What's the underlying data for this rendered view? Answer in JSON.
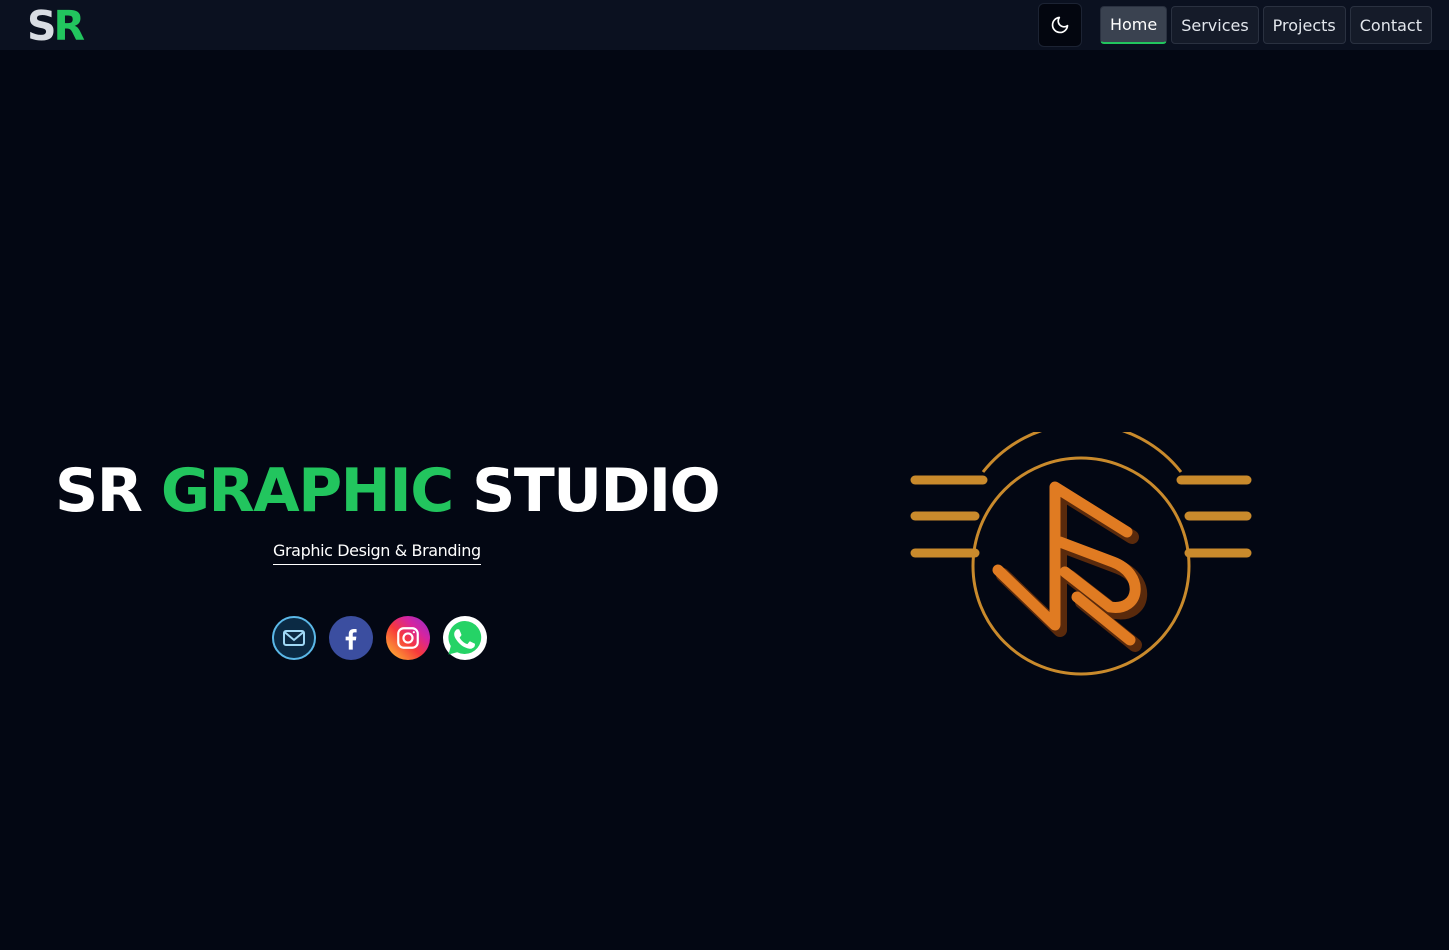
{
  "header": {
    "logo": {
      "first": "S",
      "second": "R"
    },
    "nav": [
      {
        "label": "Home",
        "active": true
      },
      {
        "label": "Services",
        "active": false
      },
      {
        "label": "Projects",
        "active": false
      },
      {
        "label": "Contact",
        "active": false
      }
    ],
    "theme_toggle_icon": "moon-icon"
  },
  "hero": {
    "title_part1": "SR ",
    "title_part2": "GRAPHIC",
    "title_part3": " STUDIO",
    "subtitle": "Graphic Design & Branding",
    "socials": [
      {
        "name": "email",
        "icon": "mail-icon"
      },
      {
        "name": "facebook",
        "icon": "facebook-icon"
      },
      {
        "name": "instagram",
        "icon": "instagram-icon"
      },
      {
        "name": "whatsapp",
        "icon": "whatsapp-icon"
      }
    ]
  },
  "colors": {
    "background": "#030713",
    "navbar": "#0b1120",
    "accent_green": "#22c55e",
    "emblem_gold": "#c98a2c",
    "emblem_orange": "#e07b22"
  }
}
